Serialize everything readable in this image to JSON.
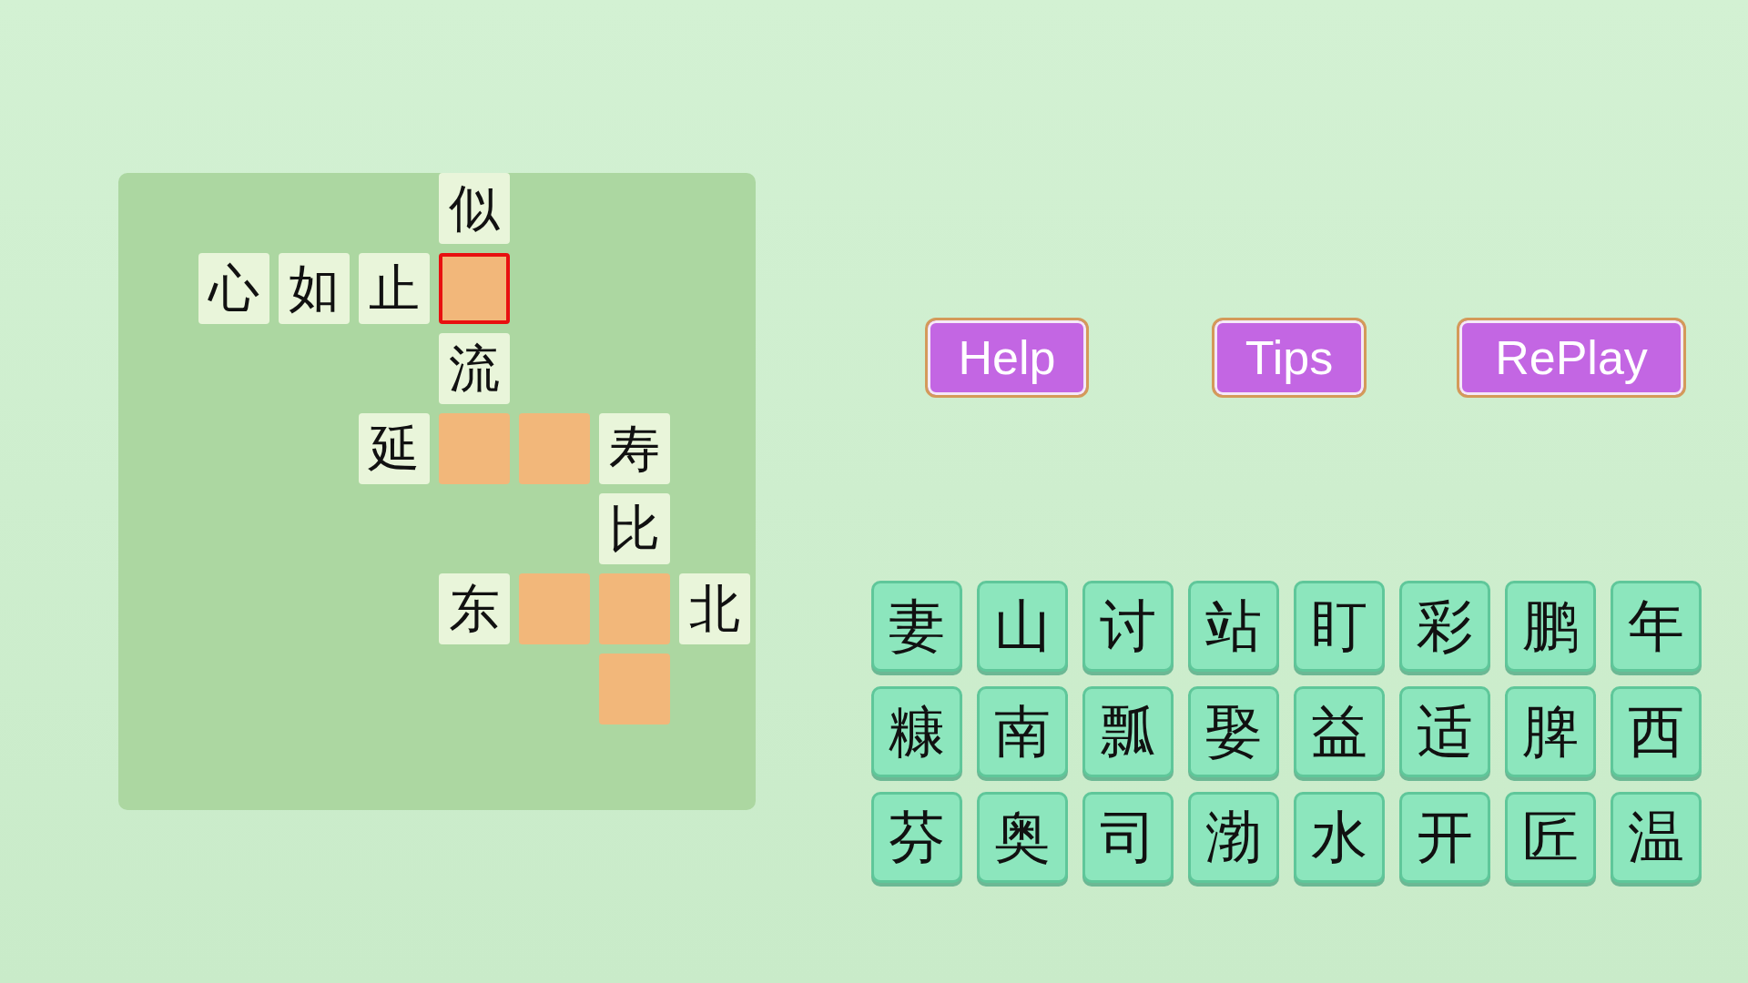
{
  "board": {
    "rows": [
      [
        {
          "kind": "empty"
        },
        {
          "kind": "empty"
        },
        {
          "kind": "empty"
        },
        {
          "kind": "empty"
        },
        {
          "kind": "char",
          "text": "似"
        },
        {
          "kind": "empty"
        },
        {
          "kind": "empty"
        },
        {
          "kind": "empty"
        }
      ],
      [
        {
          "kind": "empty"
        },
        {
          "kind": "char",
          "text": "心"
        },
        {
          "kind": "char",
          "text": "如"
        },
        {
          "kind": "char",
          "text": "止"
        },
        {
          "kind": "blank",
          "selected": true
        },
        {
          "kind": "empty"
        },
        {
          "kind": "empty"
        },
        {
          "kind": "empty"
        }
      ],
      [
        {
          "kind": "empty"
        },
        {
          "kind": "empty"
        },
        {
          "kind": "empty"
        },
        {
          "kind": "empty"
        },
        {
          "kind": "char",
          "text": "流"
        },
        {
          "kind": "empty"
        },
        {
          "kind": "empty"
        },
        {
          "kind": "empty"
        }
      ],
      [
        {
          "kind": "empty"
        },
        {
          "kind": "empty"
        },
        {
          "kind": "empty"
        },
        {
          "kind": "char",
          "text": "延"
        },
        {
          "kind": "blank",
          "selected": false
        },
        {
          "kind": "blank",
          "selected": false
        },
        {
          "kind": "char",
          "text": "寿"
        },
        {
          "kind": "empty"
        }
      ],
      [
        {
          "kind": "empty"
        },
        {
          "kind": "empty"
        },
        {
          "kind": "empty"
        },
        {
          "kind": "empty"
        },
        {
          "kind": "empty"
        },
        {
          "kind": "empty"
        },
        {
          "kind": "char",
          "text": "比"
        },
        {
          "kind": "empty"
        }
      ],
      [
        {
          "kind": "empty"
        },
        {
          "kind": "empty"
        },
        {
          "kind": "empty"
        },
        {
          "kind": "empty"
        },
        {
          "kind": "char",
          "text": "东"
        },
        {
          "kind": "blank",
          "selected": false
        },
        {
          "kind": "blank",
          "selected": false
        },
        {
          "kind": "char",
          "text": "北"
        }
      ],
      [
        {
          "kind": "empty"
        },
        {
          "kind": "empty"
        },
        {
          "kind": "empty"
        },
        {
          "kind": "empty"
        },
        {
          "kind": "empty"
        },
        {
          "kind": "empty"
        },
        {
          "kind": "blank",
          "selected": false
        },
        {
          "kind": "empty"
        }
      ],
      [
        {
          "kind": "empty"
        },
        {
          "kind": "empty"
        },
        {
          "kind": "empty"
        },
        {
          "kind": "empty"
        },
        {
          "kind": "empty"
        },
        {
          "kind": "empty"
        },
        {
          "kind": "empty"
        },
        {
          "kind": "empty"
        }
      ]
    ]
  },
  "buttons": [
    "Help",
    "Tips",
    "RePlay"
  ],
  "tiles": [
    "妻",
    "山",
    "讨",
    "站",
    "盯",
    "彩",
    "鹏",
    "年",
    "糠",
    "南",
    "瓢",
    "娶",
    "益",
    "适",
    "脾",
    "西",
    "芬",
    "奥",
    "司",
    "渤",
    "水",
    "开",
    "匠",
    "温"
  ]
}
